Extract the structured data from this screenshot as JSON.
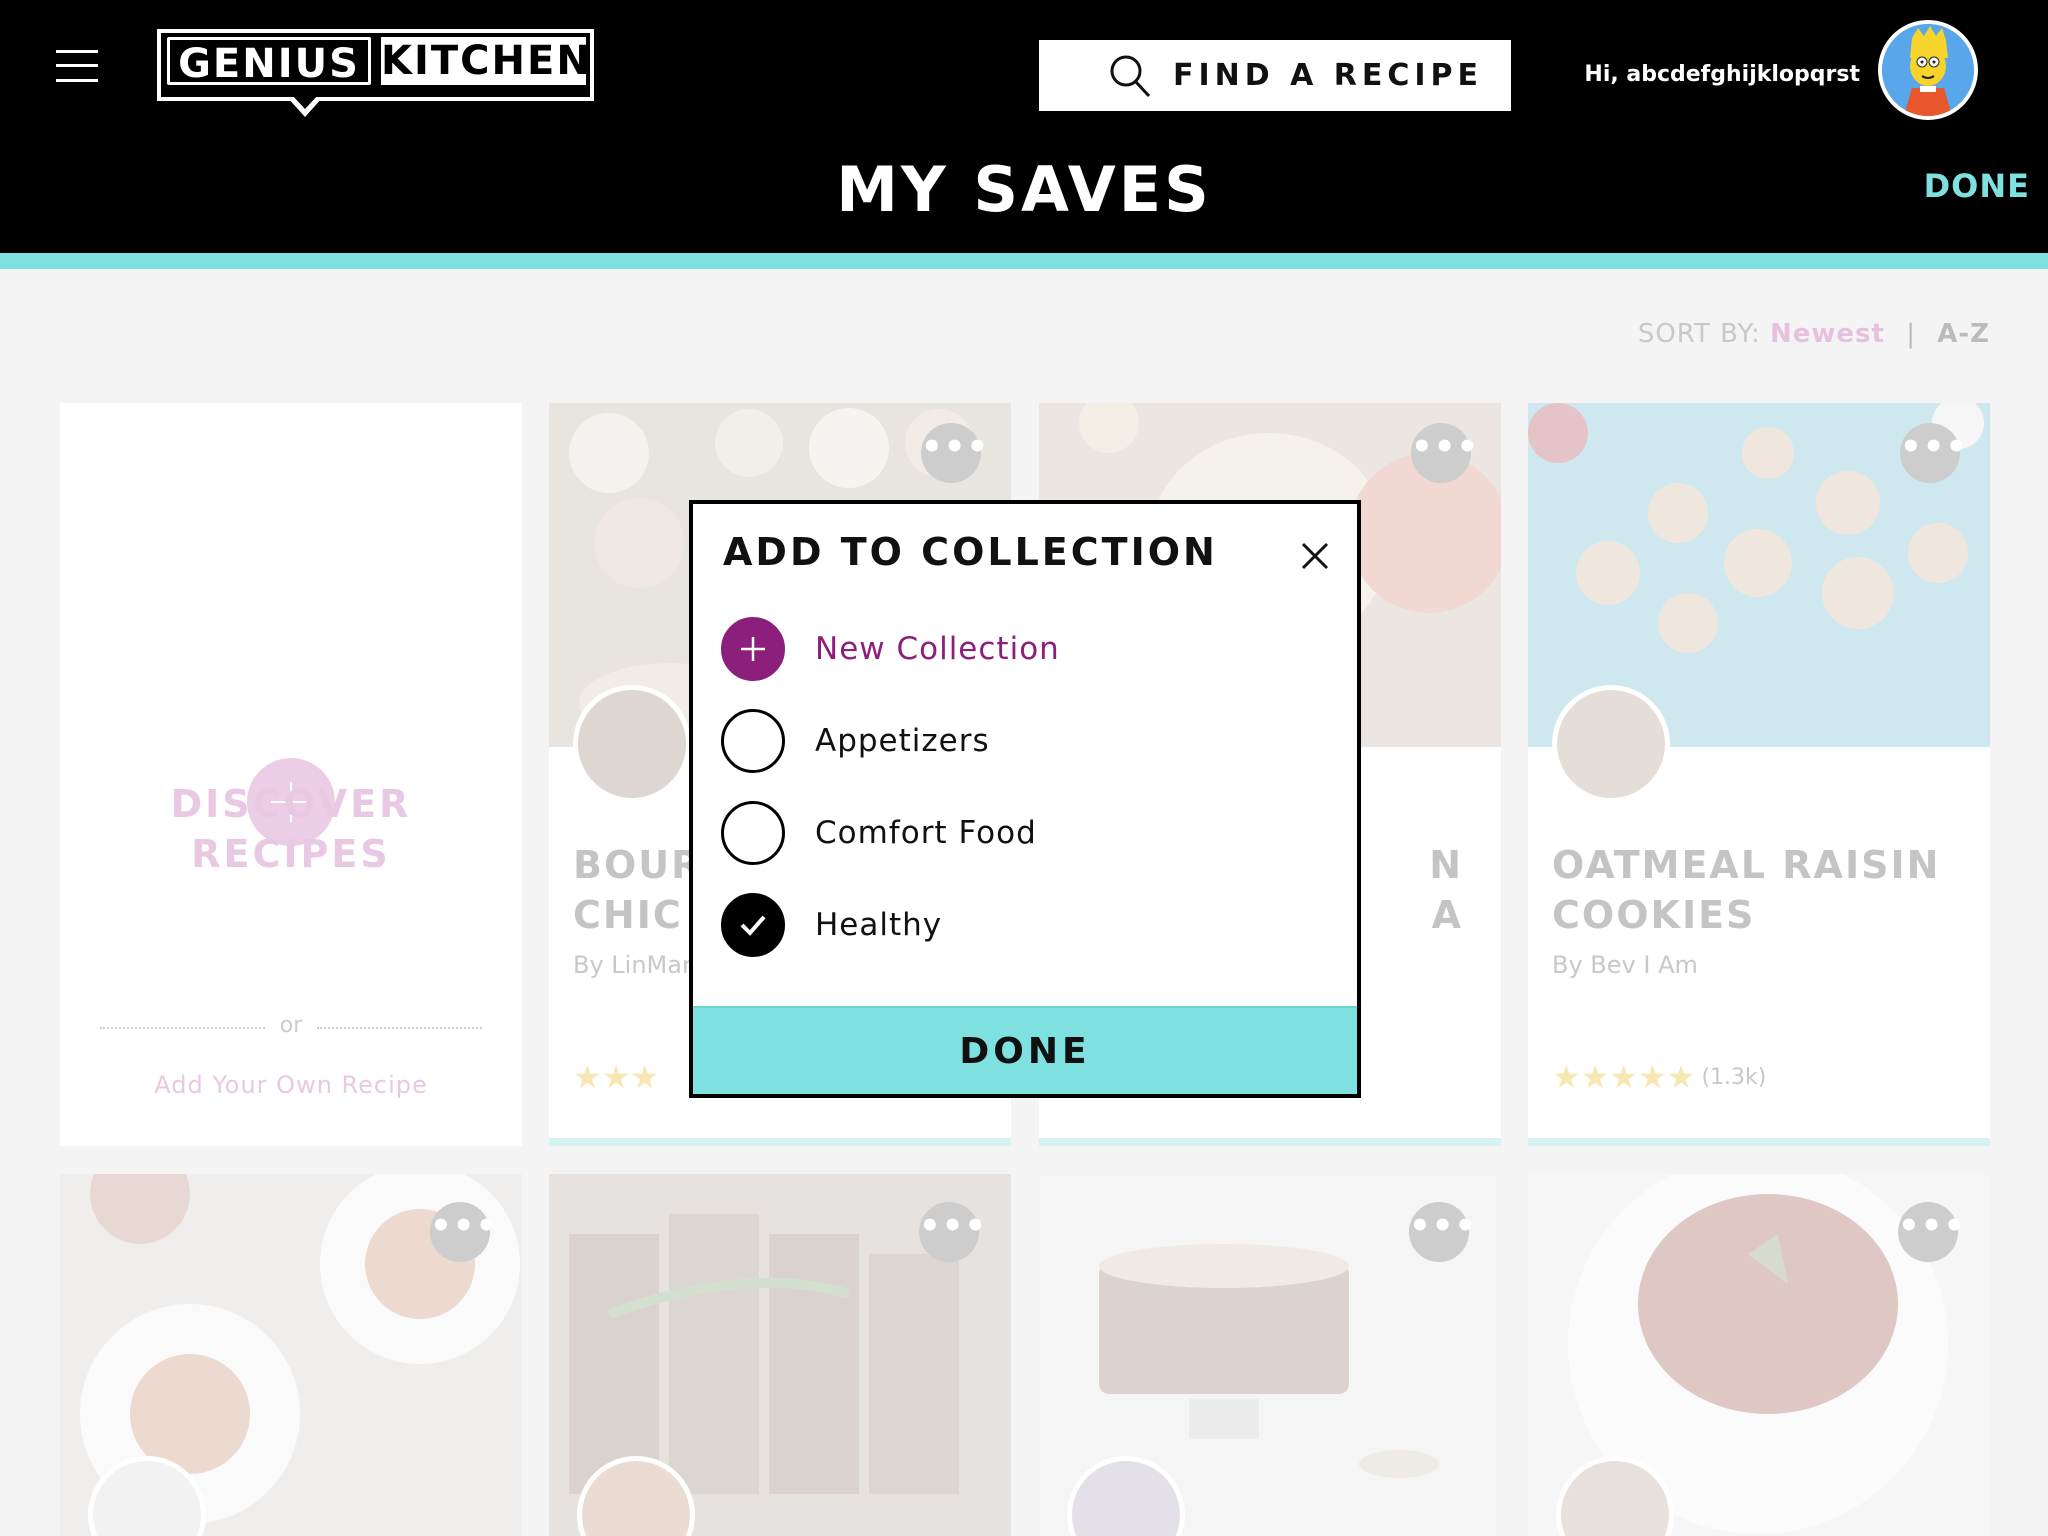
{
  "header": {
    "logo_left": "GENIUS",
    "logo_right": "KITCHEN",
    "search_label": "FIND A RECIPE",
    "greeting": "Hi, abcdefghijklopqrst",
    "title": "MY SAVES",
    "done_label": "DONE"
  },
  "sort": {
    "prefix": "SORT BY:",
    "newest": "Newest",
    "separator": "|",
    "az": "A-Z"
  },
  "discover": {
    "line1": "DISCOVER",
    "line2": "RECIPES",
    "or": "or",
    "add_own": "Add Your Own Recipe"
  },
  "cards": [
    {
      "title_line1": "BOUR",
      "title_line2": "CHIC",
      "author": "By LinMar",
      "stars": "★★★",
      "count": ""
    },
    {
      "title_line1": "N",
      "title_line2": "A",
      "author": "",
      "stars": "",
      "count": ""
    },
    {
      "title_line1": "OATMEAL RAISIN",
      "title_line2": "COOKIES",
      "author": "By Bev I Am",
      "stars": "★★★★★",
      "count": "(1.3k)"
    }
  ],
  "modal": {
    "title": "ADD TO COLLECTION",
    "options": [
      {
        "label": "New Collection",
        "state": "new"
      },
      {
        "label": "Appetizers",
        "state": "unchecked"
      },
      {
        "label": "Comfort Food",
        "state": "unchecked"
      },
      {
        "label": "Healthy",
        "state": "checked"
      }
    ],
    "done_label": "DONE"
  },
  "colors": {
    "accent_teal": "#7ee1df",
    "accent_purple": "#8b1f7b",
    "header_bg": "#000000"
  }
}
